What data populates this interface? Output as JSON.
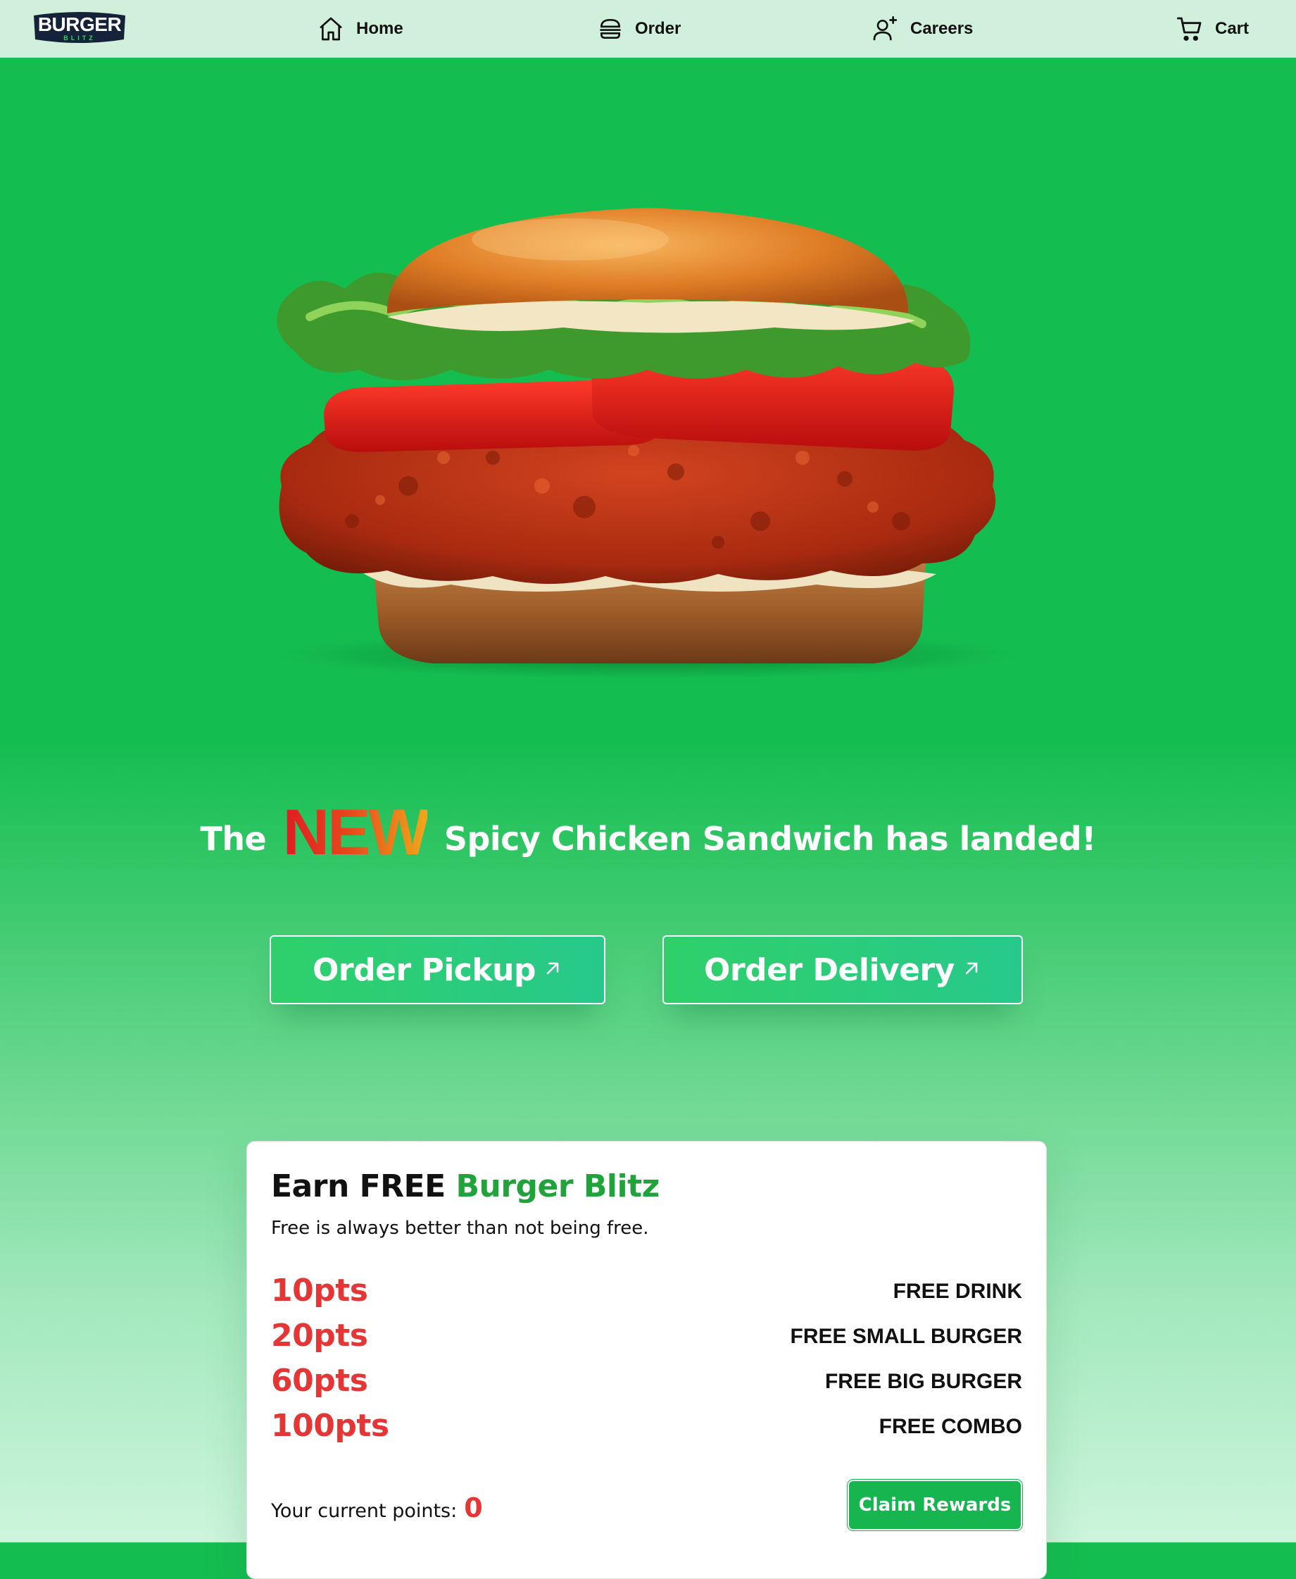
{
  "nav": {
    "logo": {
      "text_main": "BURGER",
      "text_sub": "BLITZ"
    },
    "items": [
      {
        "label": "Home",
        "icon": "home-icon"
      },
      {
        "label": "Order",
        "icon": "burger-icon"
      },
      {
        "label": "Careers",
        "icon": "add-user-icon"
      },
      {
        "label": "Cart",
        "icon": "cart-icon"
      }
    ]
  },
  "hero": {
    "image_alt": "spicy chicken sandwich",
    "headline_pre": "The",
    "headline_new": "NEW",
    "headline_post": "Spicy Chicken Sandwich has landed!"
  },
  "cta": {
    "pickup_label": "Order Pickup",
    "delivery_label": "Order Delivery",
    "arrow_icon": "arrow-up-right-icon"
  },
  "rewards": {
    "title_pre": "Earn FREE",
    "title_brand": "Burger Blitz",
    "subtitle": "Free is always better than not being free.",
    "tiers": [
      {
        "points": "10pts",
        "reward": "FREE DRINK"
      },
      {
        "points": "20pts",
        "reward": "FREE SMALL BURGER"
      },
      {
        "points": "60pts",
        "reward": "FREE BIG BURGER"
      },
      {
        "points": "100pts",
        "reward": "FREE COMBO"
      }
    ],
    "current_points_label": "Your current points:",
    "current_points_value": "0",
    "claim_label": "Claim Rewards"
  },
  "colors": {
    "brand_green": "#14bd50",
    "nav_bg": "#d1f0dc",
    "points_red": "#e63535",
    "brand_text_green": "#21a33c"
  }
}
